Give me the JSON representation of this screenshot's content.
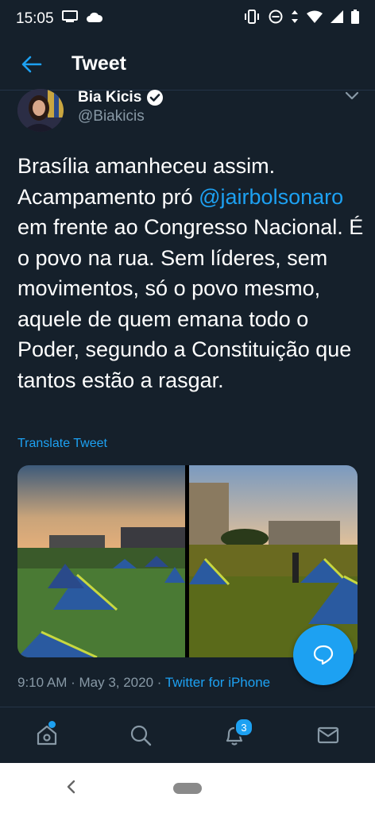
{
  "status_bar": {
    "time": "15:05"
  },
  "header": {
    "title": "Tweet"
  },
  "author": {
    "name": "Bia Kicis",
    "handle": "@Biakicis"
  },
  "tweet": {
    "text_before": "Brasília amanheceu assim. Acampamento pró ",
    "mention": "@jairbolsonaro",
    "text_after": " em frente ao Congresso Nacional. É o povo na rua. Sem líderes, sem movimentos, só o povo mesmo, aquele de quem emana todo o Poder, segundo a Constituição que tantos estão a rasgar.",
    "translate_label": "Translate Tweet",
    "timestamp": "9:10 AM · May 3, 2020 · ",
    "source": "Twitter for iPhone"
  },
  "tabbar": {
    "notifications_badge": "3"
  },
  "colors": {
    "background": "#15202b",
    "accent": "#1da1f2",
    "secondary_text": "#8899a6"
  }
}
